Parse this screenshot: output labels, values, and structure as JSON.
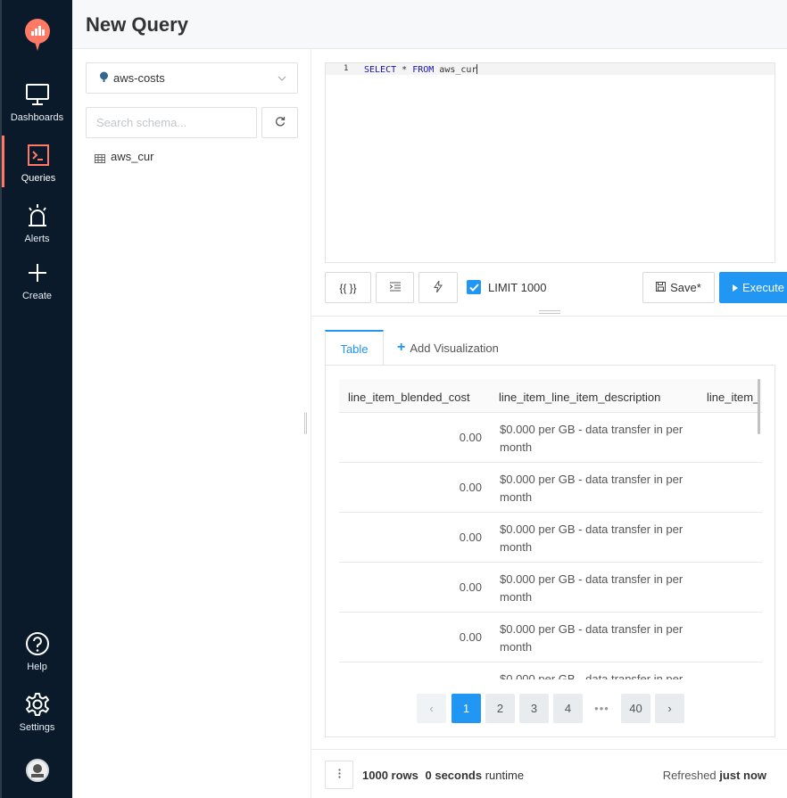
{
  "app": {
    "title": "New Query"
  },
  "nav": {
    "items": [
      {
        "label": "Dashboards",
        "icon": "monitor-icon"
      },
      {
        "label": "Queries",
        "icon": "terminal-icon",
        "active": true
      },
      {
        "label": "Alerts",
        "icon": "alarm-icon"
      },
      {
        "label": "Create",
        "icon": "plus-icon"
      }
    ],
    "bottom": [
      {
        "label": "Help",
        "icon": "help-icon"
      },
      {
        "label": "Settings",
        "icon": "gear-icon"
      }
    ]
  },
  "schema": {
    "datasource": "aws-costs",
    "search_placeholder": "Search schema...",
    "tables": [
      "aws_cur"
    ]
  },
  "editor": {
    "line_number": "1",
    "kw_select": "SELECT",
    "star": " * ",
    "kw_from": "FROM",
    "table": " aws_cur"
  },
  "toolbar": {
    "params_label": "{{ }}",
    "limit_label": "LIMIT 1000",
    "limit_checked": true,
    "save_label": "Save*",
    "execute_label": "Execute"
  },
  "tabs": {
    "table": "Table",
    "add_viz": "Add Visualization"
  },
  "results": {
    "columns": [
      "line_item_blended_cost",
      "line_item_line_item_description",
      "line_item_"
    ],
    "rows": [
      {
        "cost": "0.00",
        "desc": "$0.000 per GB - data transfer in per month"
      },
      {
        "cost": "0.00",
        "desc": "$0.000 per GB - data transfer in per month"
      },
      {
        "cost": "0.00",
        "desc": "$0.000 per GB - data transfer in per month"
      },
      {
        "cost": "0.00",
        "desc": "$0.000 per GB - data transfer in per month"
      },
      {
        "cost": "0.00",
        "desc": "$0.000 per GB - data transfer in per month"
      },
      {
        "cost": "",
        "desc": "$0.000 per GB - data transfer in per month"
      }
    ],
    "pagination": {
      "prev": "‹",
      "pages": [
        "1",
        "2",
        "3",
        "4"
      ],
      "ellipsis": "•••",
      "last": "40",
      "next": "›",
      "current": "1"
    }
  },
  "footer": {
    "rows_count": "1000 rows",
    "runtime_value": "0 seconds",
    "runtime_label": " runtime",
    "refreshed_label": "Refreshed ",
    "refreshed_value": "just now"
  },
  "colors": {
    "nav_bg": "#0b1a2a",
    "accent": "#2196f3",
    "logo": "#ff7964"
  }
}
